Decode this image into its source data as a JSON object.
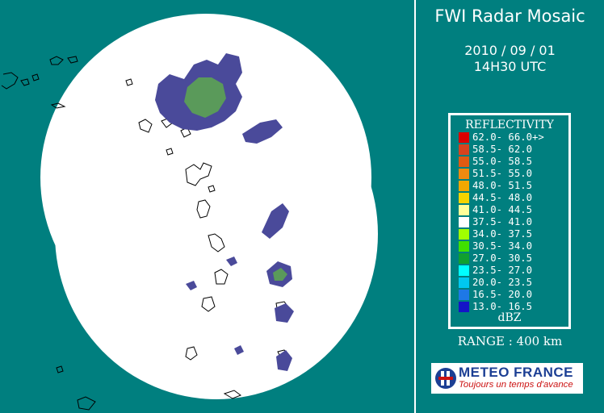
{
  "header": {
    "title": "FWI Radar Mosaic",
    "date": "2010 / 09 / 01",
    "time": "14H30 UTC"
  },
  "legend": {
    "title": "REFLECTIVITY",
    "unit": "dBZ",
    "rows": [
      {
        "range": "62.0- 66.0+>",
        "color": "#dd0000"
      },
      {
        "range": "58.5- 62.0",
        "color": "#d8431e"
      },
      {
        "range": "55.0- 58.5",
        "color": "#e05a12"
      },
      {
        "range": "51.5- 55.0",
        "color": "#ee8a10"
      },
      {
        "range": "48.0- 51.5",
        "color": "#f0a800"
      },
      {
        "range": "44.5- 48.0",
        "color": "#f4d400"
      },
      {
        "range": "41.0- 44.5",
        "color": "#ffff99"
      },
      {
        "range": "37.5- 41.0",
        "color": "#ffffff"
      },
      {
        "range": "34.0- 37.5",
        "color": "#a0ff00"
      },
      {
        "range": "30.5- 34.0",
        "color": "#40e000"
      },
      {
        "range": "27.0- 30.5",
        "color": "#10a030"
      },
      {
        "range": "23.5- 27.0",
        "color": "#00ffff"
      },
      {
        "range": "20.0- 23.5",
        "color": "#00c8f0"
      },
      {
        "range": "16.5- 20.0",
        "color": "#1e78e6"
      },
      {
        "range": "13.0- 16.5",
        "color": "#1414c8"
      }
    ]
  },
  "range_text": "RANGE : 400 km",
  "logo": {
    "name": "METEO FRANCE",
    "tagline": "Toujours un temps d'avance"
  },
  "colors": {
    "background": "#007f7f",
    "coverage": "#ffffff",
    "echo_low": "#4a4a9a",
    "echo_mid": "#5a9a5a"
  }
}
